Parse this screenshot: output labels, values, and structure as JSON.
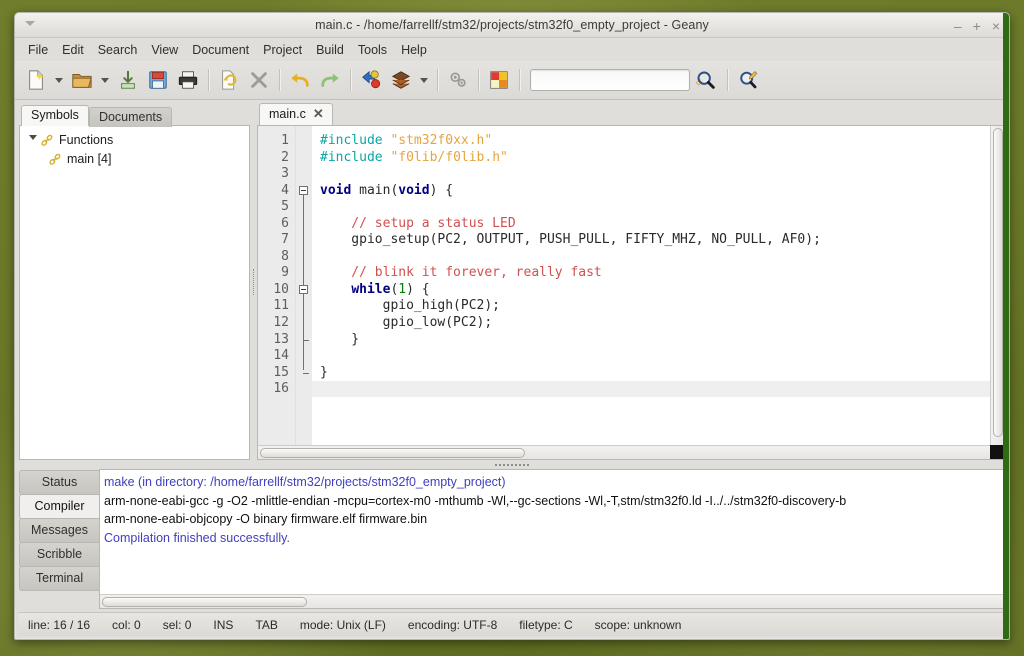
{
  "window": {
    "title": "main.c - /home/farrellf/stm32/projects/stm32f0_empty_project - Geany",
    "menu_arrow_icon": "caret-down-icon",
    "buttons": {
      "minimize": "–",
      "maximize": "+",
      "close": "×"
    }
  },
  "menubar": {
    "items": [
      "File",
      "Edit",
      "Search",
      "View",
      "Document",
      "Project",
      "Build",
      "Tools",
      "Help"
    ]
  },
  "toolbar": {
    "items": [
      {
        "name": "new-document-icon",
        "kind": "icon"
      },
      {
        "name": "new-document-dropdown-arrow",
        "kind": "arrow"
      },
      {
        "name": "open-folder-icon",
        "kind": "icon"
      },
      {
        "name": "open-recent-dropdown-arrow",
        "kind": "arrow"
      },
      {
        "name": "save-icon",
        "kind": "icon"
      },
      {
        "name": "save-all-icon",
        "kind": "icon"
      },
      {
        "name": "print-icon",
        "kind": "icon"
      },
      {
        "name": "separator",
        "kind": "sep"
      },
      {
        "name": "reload-icon",
        "kind": "icon"
      },
      {
        "name": "close-document-icon",
        "kind": "icon"
      },
      {
        "name": "separator",
        "kind": "sep"
      },
      {
        "name": "undo-icon",
        "kind": "icon"
      },
      {
        "name": "redo-icon",
        "kind": "icon"
      },
      {
        "name": "separator",
        "kind": "sep"
      },
      {
        "name": "navigate-back-icon",
        "kind": "icon"
      },
      {
        "name": "build-icon",
        "kind": "icon"
      },
      {
        "name": "build-dropdown-arrow",
        "kind": "arrow"
      },
      {
        "name": "separator",
        "kind": "sep"
      },
      {
        "name": "compile-gears-icon",
        "kind": "icon"
      },
      {
        "name": "separator",
        "kind": "sep"
      },
      {
        "name": "color-chooser-icon",
        "kind": "icon"
      },
      {
        "name": "separator",
        "kind": "sep"
      }
    ],
    "search_value": "",
    "search_placeholder": "",
    "search_clear_icon": "broom-icon",
    "find_icon": "magnifier-icon",
    "jump_to_icon": "magnifier-pencil-icon"
  },
  "sidebar": {
    "tabs": [
      {
        "label": "Symbols",
        "active": true
      },
      {
        "label": "Documents",
        "active": false
      }
    ],
    "tree": [
      {
        "label": "Functions",
        "icon": "chain-link-icon",
        "expander": "triangle-down-icon",
        "level": 0
      },
      {
        "label": "main [4]",
        "icon": "chain-link-icon",
        "expander": "",
        "level": 1
      }
    ]
  },
  "editor": {
    "tab": {
      "label": "main.c",
      "close_icon": "close-icon"
    },
    "line_numbers": [
      "1",
      "2",
      "3",
      "4",
      "5",
      "6",
      "7",
      "8",
      "9",
      "10",
      "11",
      "12",
      "13",
      "14",
      "15",
      "16"
    ],
    "lines": [
      {
        "n": 1,
        "tokens": [
          {
            "t": "#include ",
            "c": "pre"
          },
          {
            "t": "\"stm32f0xx.h\"",
            "c": "str"
          }
        ]
      },
      {
        "n": 2,
        "tokens": [
          {
            "t": "#include ",
            "c": "pre"
          },
          {
            "t": "\"f0lib/f0lib.h\"",
            "c": "str"
          }
        ]
      },
      {
        "n": 3,
        "tokens": []
      },
      {
        "n": 4,
        "tokens": [
          {
            "t": "void",
            "c": "kw"
          },
          {
            "t": " main(",
            "c": ""
          },
          {
            "t": "void",
            "c": "kw"
          },
          {
            "t": ") {",
            "c": ""
          }
        ]
      },
      {
        "n": 5,
        "tokens": []
      },
      {
        "n": 6,
        "tokens": [
          {
            "t": "    // setup a status LED",
            "c": "cmt"
          }
        ]
      },
      {
        "n": 7,
        "tokens": [
          {
            "t": "    gpio_setup(PC2, OUTPUT, PUSH_PULL, FIFTY_MHZ, NO_PULL, AF0);",
            "c": ""
          }
        ]
      },
      {
        "n": 8,
        "tokens": []
      },
      {
        "n": 9,
        "tokens": [
          {
            "t": "    // blink it forever, really fast",
            "c": "cmt"
          }
        ]
      },
      {
        "n": 10,
        "tokens": [
          {
            "t": "    ",
            "c": ""
          },
          {
            "t": "while",
            "c": "kw"
          },
          {
            "t": "(",
            "c": ""
          },
          {
            "t": "1",
            "c": "num"
          },
          {
            "t": ") {",
            "c": ""
          }
        ]
      },
      {
        "n": 11,
        "tokens": [
          {
            "t": "        gpio_high(PC2);",
            "c": ""
          }
        ]
      },
      {
        "n": 12,
        "tokens": [
          {
            "t": "        gpio_low(PC2);",
            "c": ""
          }
        ]
      },
      {
        "n": 13,
        "tokens": [
          {
            "t": "    }",
            "c": ""
          }
        ]
      },
      {
        "n": 14,
        "tokens": []
      },
      {
        "n": 15,
        "tokens": [
          {
            "t": "}",
            "c": ""
          }
        ]
      },
      {
        "n": 16,
        "tokens": []
      }
    ],
    "fold_points": [
      4,
      10
    ],
    "fold_end": 15
  },
  "messages": {
    "tabs": [
      {
        "label": "Status",
        "active": false
      },
      {
        "label": "Compiler",
        "active": true
      },
      {
        "label": "Messages",
        "active": false
      },
      {
        "label": "Scribble",
        "active": false
      },
      {
        "label": "Terminal",
        "active": false
      }
    ],
    "lines": [
      {
        "text": "make (in directory: /home/farrellf/stm32/projects/stm32f0_empty_project)",
        "accent": true
      },
      {
        "text": "arm-none-eabi-gcc -g -O2 -mlittle-endian -mcpu=cortex-m0  -mthumb  -Wl,--gc-sections -Wl,-T,stm/stm32f0.ld -I../../stm32f0-discovery-b",
        "accent": false
      },
      {
        "text": "arm-none-eabi-objcopy -O binary firmware.elf firmware.bin",
        "accent": false
      },
      {
        "text": "Compilation finished successfully.",
        "accent": true
      }
    ]
  },
  "statusbar": {
    "items": [
      "line: 16 / 16",
      "col: 0",
      "sel: 0",
      "INS",
      "TAB",
      "mode: Unix (LF)",
      "encoding: UTF-8",
      "filetype: C",
      "scope: unknown"
    ]
  },
  "colors": {
    "accent_blue": "#3f3fbf",
    "keyword": "#00007f",
    "preprocessor": "#0aa6a6",
    "string": "#e8a33d",
    "comment": "#d05050",
    "number": "#007f00",
    "desktop": "#6a7828"
  }
}
